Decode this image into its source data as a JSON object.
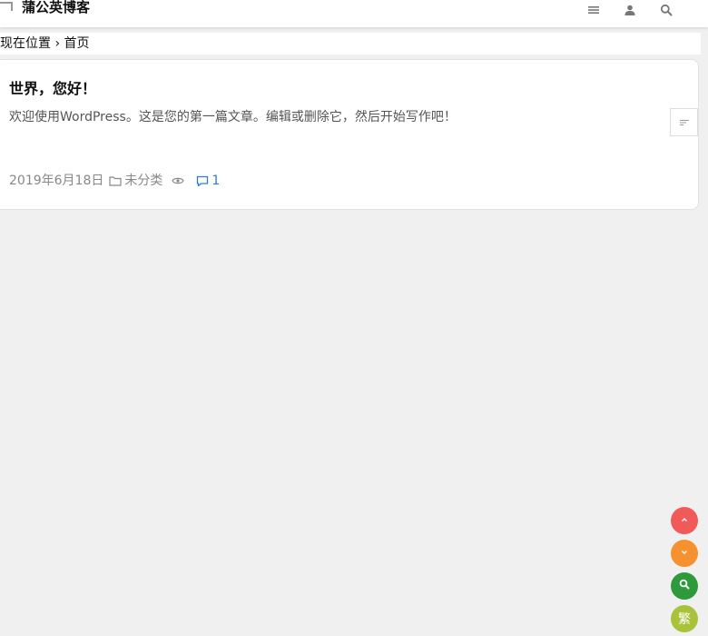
{
  "header": {
    "site_title": "蒲公英博客",
    "icons": [
      "menu-icon",
      "user-icon",
      "search-icon"
    ]
  },
  "breadcrumb": {
    "prefix": "现在位置",
    "separator": "›",
    "home": "首页"
  },
  "post": {
    "title": "世界，您好！",
    "excerpt": "欢迎使用WordPress。这是您的第一篇文章。编辑或删除它，然后开始写作吧！",
    "date": "2019年6月18日",
    "category": "未分类",
    "comment_count": "1"
  },
  "floating": {
    "traditional_label": "繁",
    "colors": {
      "top": "#f25a5a",
      "bottom": "#f5912e",
      "search": "#2e9a3c",
      "traditional": "#a8c33a"
    }
  }
}
